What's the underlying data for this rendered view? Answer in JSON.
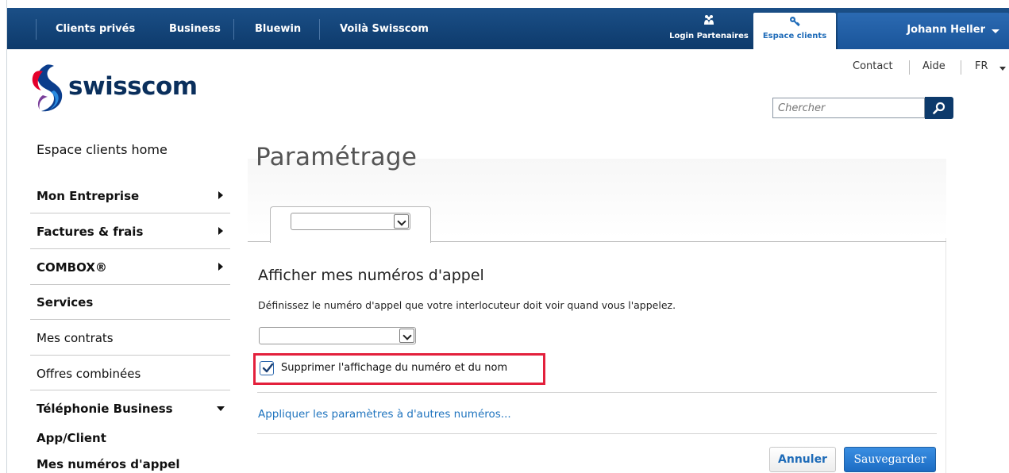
{
  "topnav": {
    "items": [
      "Clients privés",
      "Business",
      "Bluewin",
      "Voilà Swisscom"
    ],
    "login_partners": "Login Partenaires",
    "customer_area": "Espace clients",
    "user_name": "Johann Heller"
  },
  "header": {
    "logo_text": "swisscom",
    "links": {
      "contact": "Contact",
      "help": "Aide",
      "language": "FR"
    },
    "search_placeholder": "Chercher"
  },
  "sidebar": {
    "home": "Espace clients home",
    "items": [
      {
        "label": "Mon Entreprise",
        "expand": "right"
      },
      {
        "label": "Factures & frais",
        "expand": "right"
      },
      {
        "label": "COMBOX®",
        "expand": "right"
      },
      {
        "label": "Services"
      },
      {
        "label": "Mes contrats"
      },
      {
        "label": "Offres combinées"
      },
      {
        "label": "Téléphonie Business",
        "expand": "down"
      }
    ],
    "subitems": [
      "App/Client",
      "Mes numéros d'appel"
    ]
  },
  "main": {
    "title": "Paramétrage",
    "tab_select_value": "",
    "section_title": "Afficher mes numéros d'appel",
    "section_desc": "Définissez le numéro d'appel que votre interlocuteur doit voir quand vous l'appelez.",
    "number_select_value": "",
    "suppress_label": "Supprimer l'affichage du numéro et du nom",
    "suppress_checked": true,
    "apply_link": "Appliquer les paramètres à d'autres numéros...",
    "cancel_label": "Annuler",
    "save_label": "Sauvegarder"
  },
  "colors": {
    "nav_bg": "#0d3a6b",
    "accent": "#1e6bb8",
    "highlight": "#e3203c"
  }
}
